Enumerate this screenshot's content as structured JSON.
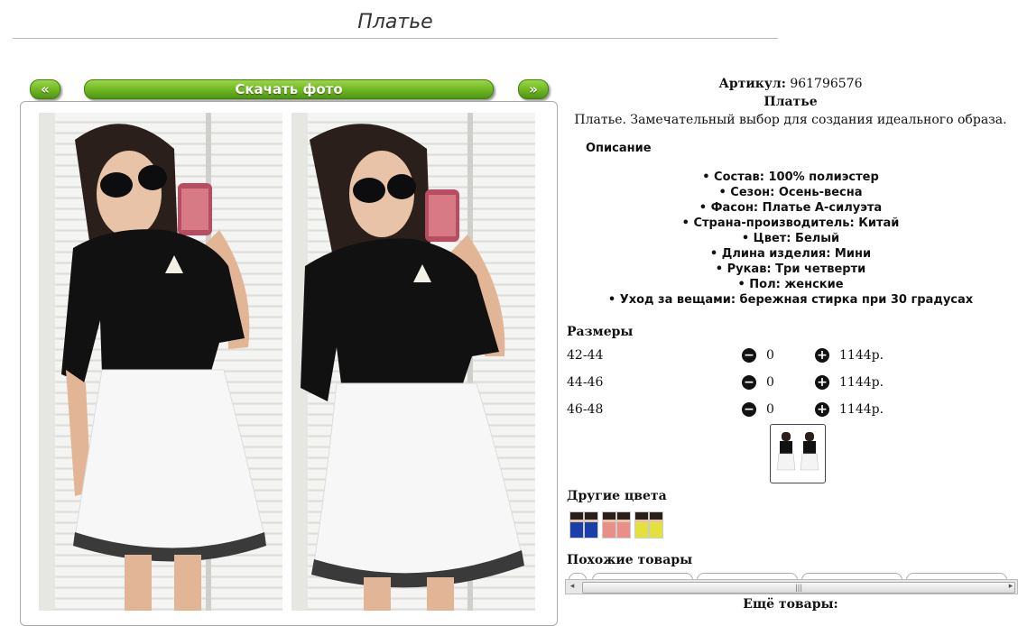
{
  "page": {
    "title": "Платье"
  },
  "nav": {
    "prev": "«",
    "download": "Скачать фото",
    "next": "»"
  },
  "product": {
    "article_label": "Артикул:",
    "article_value": "961796576",
    "name": "Платье",
    "description": "Платье. Замечательный выбор для создания идеального образа.",
    "desc_heading": "Описание",
    "features": [
      "Состав: 100% полиэстер",
      "Сезон: Осень-весна",
      "Фасон: Платье А-силуэта",
      "Страна-производитель: Китай",
      "Цвет: Белый",
      "Длина изделия: Мини",
      "Рукав: Три четверти",
      "Пол: женские",
      "Уход за вещами: бережная стирка при 30 градусах"
    ]
  },
  "sizes": {
    "heading": "Размеры",
    "rows": [
      {
        "size": "42-44",
        "qty": "0",
        "price": "1144р."
      },
      {
        "size": "44-46",
        "qty": "0",
        "price": "1144р."
      },
      {
        "size": "46-48",
        "qty": "0",
        "price": "1144р."
      }
    ]
  },
  "other_colors": {
    "heading": "Другие цвета",
    "swatches": [
      "#1a3fa8",
      "#e88f8a",
      "#e3e040"
    ]
  },
  "similar": {
    "heading": "Похожие товары"
  },
  "more": {
    "label": "Ещё товары:"
  },
  "colors": {
    "button_green": "#6db622",
    "skirt": "#f7f7f7",
    "top": "#111111"
  }
}
